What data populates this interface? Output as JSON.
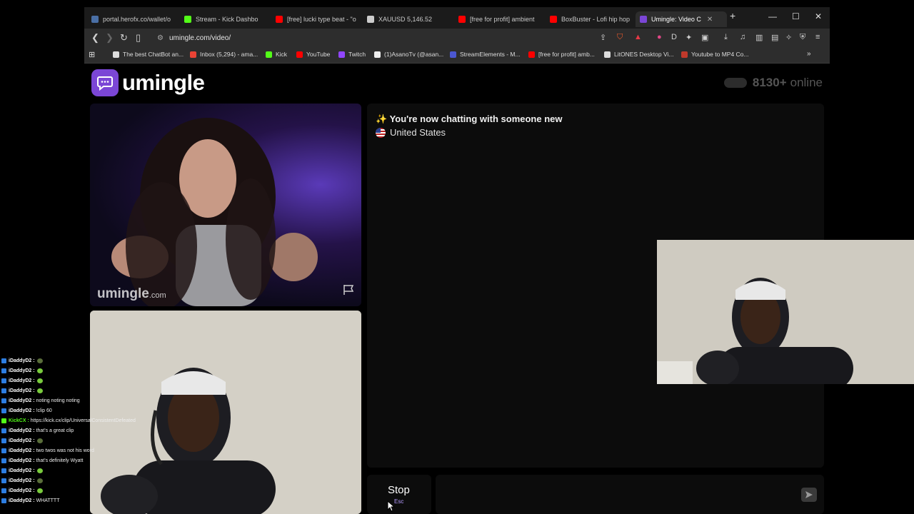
{
  "browser": {
    "tabs": [
      {
        "label": "portal.herofx.co/wallet/o",
        "color": "#4a6fa5",
        "active": false
      },
      {
        "label": "Stream - Kick Dashbo",
        "color": "#53fc18",
        "active": false
      },
      {
        "label": "[free] lucki type beat - \"o",
        "color": "#ff0000",
        "active": false
      },
      {
        "label": "XAUUSD 5,146.52",
        "color": "#cccccc",
        "active": false
      },
      {
        "label": "[free for profit] ambient",
        "color": "#ff0000",
        "active": false
      },
      {
        "label": "BoxBuster - Lofi hip hop",
        "color": "#ff0000",
        "active": false
      },
      {
        "label": "Umingle: Video C",
        "color": "#7b46d6",
        "active": true
      }
    ],
    "url": "umingle.com/video/",
    "bookmarks": [
      {
        "label": "The best ChatBot an...",
        "color": "#dddddd"
      },
      {
        "label": "Inbox (5,294) - ama...",
        "color": "#ea4335"
      },
      {
        "label": "Kick",
        "color": "#53fc18"
      },
      {
        "label": "YouTube",
        "color": "#ff0000"
      },
      {
        "label": "Twitch",
        "color": "#9146ff"
      },
      {
        "label": "(1)AsanoTv (@asan...",
        "color": "#eeeeee"
      },
      {
        "label": "StreamElements - M...",
        "color": "#4b57d1"
      },
      {
        "label": "[free for profit] amb...",
        "color": "#ff0000"
      },
      {
        "label": "LitONES Desktop Vi...",
        "color": "#dddddd"
      },
      {
        "label": "Youtube to MP4 Co...",
        "color": "#c0392b"
      }
    ]
  },
  "site": {
    "logo_text": "umingle",
    "online_count": "8130+",
    "online_label": "online",
    "watermark_main": "umingle",
    "watermark_suffix": ".com",
    "chat_message": "✨ You're now chatting with someone new",
    "country": "United States",
    "stop_label": "Stop",
    "stop_shortcut": "Esc",
    "accent_color": "#7b46d6"
  },
  "stream_chat": [
    {
      "user": "iDaddyD2 :",
      "text": "",
      "emote": "dim"
    },
    {
      "user": "iDaddyD2 :",
      "text": "",
      "emote": "green"
    },
    {
      "user": "iDaddyD2 :",
      "text": "",
      "emote": "green"
    },
    {
      "user": "iDaddyD2 :",
      "text": "",
      "emote": "green"
    },
    {
      "user": "iDaddyD2 :",
      "text": "noting noting noting",
      "emote": ""
    },
    {
      "user": "iDaddyD2 :",
      "text": "!clip 60",
      "emote": ""
    },
    {
      "user": "KickCX :",
      "text": "https://kick.cx/clip/UniversalConsistentDefeated",
      "emote": ""
    },
    {
      "user": "iDaddyD2 :",
      "text": "that's a great clip",
      "emote": ""
    },
    {
      "user": "iDaddyD2 :",
      "text": "",
      "emote": "dim"
    },
    {
      "user": "iDaddyD2 :",
      "text": "two twos was not his word",
      "emote": ""
    },
    {
      "user": "iDaddyD2 :",
      "text": "that's definitely Wyatt",
      "emote": ""
    },
    {
      "user": "iDaddyD2 :",
      "text": "",
      "emote": "green"
    },
    {
      "user": "iDaddyD2 :",
      "text": "",
      "emote": "dim"
    },
    {
      "user": "iDaddyD2 :",
      "text": "",
      "emote": "green"
    },
    {
      "user": "iDaddyD2 :",
      "text": "WHATTTT",
      "emote": ""
    }
  ]
}
